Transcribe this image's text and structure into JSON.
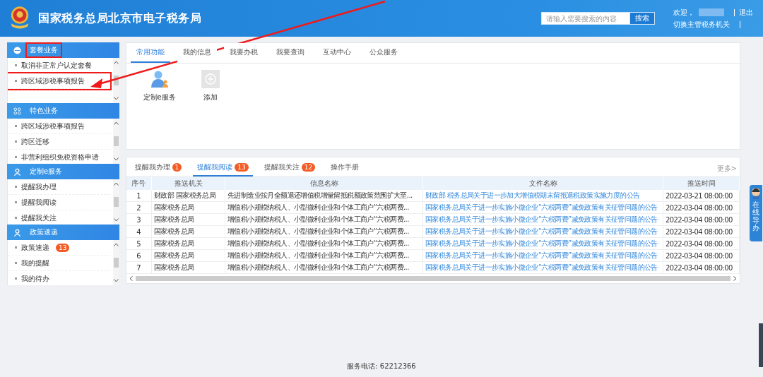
{
  "header": {
    "title": "国家税务总局北京市电子税务局",
    "search": {
      "placeholder": "请输入需要搜索的内容",
      "button": "搜索"
    },
    "welcome": "欢迎，",
    "logout": "退出",
    "switch_agency": "切换主管税务机关"
  },
  "sidebar": {
    "panels": [
      {
        "title": "套餐业务",
        "annotated": true,
        "items": [
          {
            "label": "取消非正常户认定套餐",
            "annotated": false
          },
          {
            "label": "跨区域涉税事项报告",
            "annotated": true
          }
        ]
      },
      {
        "title": "特色业务",
        "annotated": false,
        "items": [
          {
            "label": "跨区域涉税事项报告",
            "annotated": false
          },
          {
            "label": "跨区迁移",
            "annotated": false
          },
          {
            "label": "非营利组织免税资格申请",
            "annotated": false
          }
        ]
      },
      {
        "title": "定制e服务",
        "annotated": false,
        "items": [
          {
            "label": "提醒我办理",
            "annotated": false
          },
          {
            "label": "提醒我阅读",
            "annotated": false
          },
          {
            "label": "提醒我关注",
            "annotated": false
          }
        ]
      },
      {
        "title": "政策速递",
        "annotated": false,
        "items": [
          {
            "label": "政策速递",
            "badge": "13",
            "annotated": false
          },
          {
            "label": "我的提醒",
            "annotated": false
          },
          {
            "label": "我的待办",
            "annotated": false
          }
        ]
      }
    ]
  },
  "main": {
    "tabs": [
      {
        "label": "常用功能",
        "selected": true
      },
      {
        "label": "我的信息",
        "selected": false
      },
      {
        "label": "我要办税",
        "selected": false
      },
      {
        "label": "我要查询",
        "selected": false
      },
      {
        "label": "互动中心",
        "selected": false
      },
      {
        "label": "公众服务",
        "selected": false
      }
    ],
    "shortcuts": [
      {
        "label": "定制e服务",
        "kind": "service"
      },
      {
        "label": "添加",
        "kind": "add"
      }
    ],
    "reminder_tabs": [
      {
        "label": "提醒我办理",
        "count": "1",
        "selected": false
      },
      {
        "label": "提醒我阅读",
        "count": "13",
        "selected": true
      },
      {
        "label": "提醒我关注",
        "count": "12",
        "selected": false
      },
      {
        "label": "操作手册",
        "selected": false
      }
    ],
    "more_link": "更多>",
    "table": {
      "columns": [
        "序号",
        "推送机关",
        "信息名称",
        "文件名称",
        "推送时间"
      ],
      "rows": [
        [
          "1",
          "财政部 国家税务总局",
          "先进制造业按月全额退还增值税增量留抵税额政策范围扩大至...",
          "财政部 税务总局关于进一步加大增值税期末留抵退税政策实施力度的公告",
          "2022-03-21 08:00:00"
        ],
        [
          "2",
          "国家税务总局",
          "增值税小规模纳税人、小型微利企业和个体工商户“六税两费...",
          "国家税务总局关于进一步实施小微企业“六税两费”减免政策有关征管问题的公告",
          "2022-03-04 08:00:00"
        ],
        [
          "3",
          "国家税务总局",
          "增值税小规模纳税人、小型微利企业和个体工商户“六税两费...",
          "国家税务总局关于进一步实施小微企业“六税两费”减免政策有关征管问题的公告",
          "2022-03-04 08:00:00"
        ],
        [
          "4",
          "国家税务总局",
          "增值税小规模纳税人、小型微利企业和个体工商户“六税两费...",
          "国家税务总局关于进一步实施小微企业“六税两费”减免政策有关征管问题的公告",
          "2022-03-04 08:00:00"
        ],
        [
          "5",
          "国家税务总局",
          "增值税小规模纳税人、小型微利企业和个体工商户“六税两费...",
          "国家税务总局关于进一步实施小微企业“六税两费”减免政策有关征管问题的公告",
          "2022-03-04 08:00:00"
        ],
        [
          "6",
          "国家税务总局",
          "增值税小规模纳税人、小型微利企业和个体工商户“六税两费...",
          "国家税务总局关于进一步实施小微企业“六税两费”减免政策有关征管问题的公告",
          "2022-03-04 08:00:00"
        ],
        [
          "7",
          "国家税务总局",
          "增值税小规模纳税人、小型微利企业和个体工商户“六税两费...",
          "国家税务总局关于进一步实施小微企业“六税两费”减免政策有关征管问题的公告",
          "2022-03-04 08:00:00"
        ]
      ]
    }
  },
  "chat_widget": {
    "label": "在线导办"
  },
  "footer": {
    "phone": "服务电话: 62212366"
  }
}
